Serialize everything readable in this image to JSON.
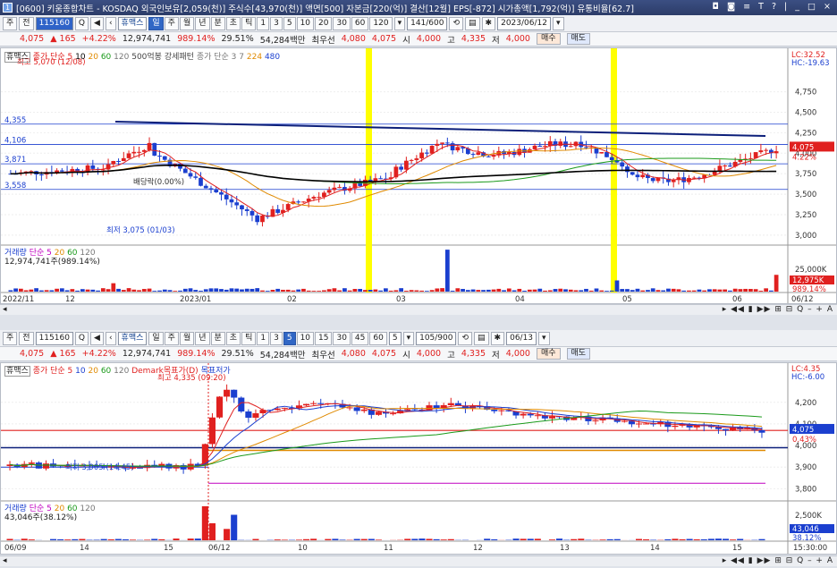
{
  "window": {
    "title": "[0600] 키움종합차트 - KOSDAQ 외국인보유[2,059(천)] 주식수[43,970(천)] 액면[500] 자본금[220(억)] 결산[12월] EPS[-872] 시가총액[1,792(억)] 유통비율[62.7]",
    "icon": "1",
    "controls": "◘ ◙ ≡ T ? | _ □ ×"
  },
  "top": {
    "toolbar": {
      "select_a": "주",
      "select_b": "전",
      "code": "115160",
      "name": "휴맥스",
      "periods": [
        "일",
        "주",
        "월",
        "년",
        "분",
        "초",
        "틱",
        "1",
        "3",
        "5",
        "10",
        "20",
        "30",
        "60",
        "120"
      ],
      "period_selected": "일",
      "count": "141/600",
      "date": "2023/06/12"
    },
    "quote": {
      "price": "4,075",
      "change": "▲ 165",
      "rate": "+4.22%",
      "volume": "12,974,741",
      "vol_ratio": "989.14%",
      "turnover": "29.51%",
      "amount": "54,284백만",
      "pref_label": "최우선",
      "ask": "4,080",
      "bid": "4,075",
      "open_label": "시",
      "open": "4,000",
      "high_label": "고",
      "high": "4,335",
      "low_label": "저",
      "low": "4,000",
      "buy": "매수",
      "sell": "매도"
    },
    "price_legend": [
      "휴맥스",
      "종가 단순 5",
      "10",
      "20",
      "60",
      "120",
      "500억봉 강세패턴",
      "종가 단순 3",
      "7",
      "224",
      "480"
    ],
    "annotations": {
      "high": "최고 5,070 (12/08)",
      "low": "최저 3,075 (01/03)",
      "dividend": "배당락(0.00%)",
      "line1": "4,355",
      "line2": "4,106",
      "line3": "3,871",
      "line4": "3,558"
    },
    "right_labels": {
      "lc": "LC:32.52",
      "hc": "HC:-19.63",
      "price_tag": "4,075",
      "pct_tag": "4.22%"
    },
    "y_ticks": [
      "4,750",
      "4,500",
      "4,250",
      "4,000",
      "3,750",
      "3,500",
      "3,250",
      "3,000"
    ],
    "volume_legend": [
      "거래량",
      "단순 5",
      "20",
      "60",
      "120"
    ],
    "volume_text": "12,974,741주(989.14%)",
    "volume_ticks": [
      "25,000K"
    ],
    "volume_tags": [
      "12,975K",
      "989.14%"
    ],
    "x_labels": [
      "2022/11",
      "12",
      "2023/01",
      "02",
      "03",
      "04",
      "05",
      "06",
      "06/12"
    ]
  },
  "bottom": {
    "toolbar": {
      "select_a": "주",
      "select_b": "전",
      "code": "115160",
      "name": "휴맥스",
      "periods": [
        "일",
        "주",
        "월",
        "년",
        "분",
        "초",
        "틱",
        "1",
        "3",
        "5",
        "10",
        "15",
        "30",
        "45",
        "60"
      ],
      "period_selected": "5",
      "interval": "5",
      "count": "105/900",
      "date": "06/13"
    },
    "quote": {
      "price": "4,075",
      "change": "▲ 165",
      "rate": "+4.22%",
      "volume": "12,974,741",
      "vol_ratio": "989.14%",
      "turnover": "29.51%",
      "amount": "54,284백만",
      "pref_label": "최우선",
      "ask": "4,080",
      "bid": "4,075",
      "open_label": "시",
      "open": "4,000",
      "high_label": "고",
      "high": "4,335",
      "low_label": "저",
      "low": "4,000",
      "buy": "매수",
      "sell": "매도"
    },
    "price_legend": [
      "휴맥스",
      "종가 단순 5",
      "10",
      "20",
      "60",
      "120",
      "Demark목표가(D)",
      "목표저가"
    ],
    "annotations": {
      "high": "최고 4,335 (09:20)",
      "low": "최저 3,905 (14:45)"
    },
    "right_labels": {
      "lc": "LC:4.35",
      "hc": "HC:-6.00",
      "price_tag": "4,075",
      "pct_tag": "0.43%"
    },
    "y_ticks": [
      "4,200",
      "4,100",
      "4,000",
      "3,900",
      "3,800"
    ],
    "volume_legend": [
      "거래량",
      "단순 5",
      "20",
      "60",
      "120"
    ],
    "volume_text": "43,046주(38.12%)",
    "volume_ticks": [
      "2,500K"
    ],
    "volume_tags": [
      "43,046",
      "38.12%"
    ],
    "x_labels": [
      "06/09",
      "14",
      "15",
      "06/12",
      "10",
      "11",
      "12",
      "13",
      "14",
      "15",
      "15:30:00"
    ]
  },
  "colors": {
    "up": "#e0201f",
    "down": "#1b3fcf",
    "highlight": "#ffff00",
    "accent": "#3167c5"
  }
}
